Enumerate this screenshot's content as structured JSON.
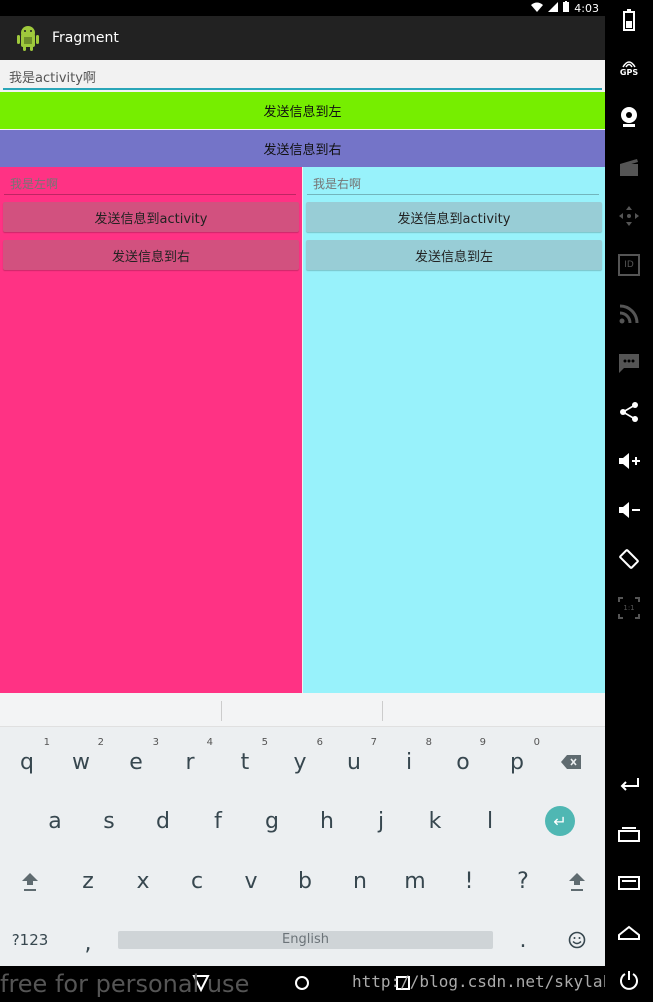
{
  "status_bar": {
    "time": "4:03"
  },
  "action_bar": {
    "title": "Fragment"
  },
  "activity": {
    "input_value": "我是activity啊",
    "send_left_label": "发送信息到左",
    "send_right_label": "发送信息到右",
    "send_left_color": "#76ee00",
    "send_right_color": "#7474c8"
  },
  "left_fragment": {
    "color": "#ff3284",
    "input_placeholder": "我是左啊",
    "button_activity": "发送信息到activity",
    "button_other": "发送信息到右"
  },
  "right_fragment": {
    "color": "#98f2fb",
    "input_placeholder": "我是右啊",
    "button_activity": "发送信息到activity",
    "button_other": "发送信息到左"
  },
  "keyboard": {
    "row1": [
      {
        "key": "q",
        "hint": "1"
      },
      {
        "key": "w",
        "hint": "2"
      },
      {
        "key": "e",
        "hint": "3"
      },
      {
        "key": "r",
        "hint": "4"
      },
      {
        "key": "t",
        "hint": "5"
      },
      {
        "key": "y",
        "hint": "6"
      },
      {
        "key": "u",
        "hint": "7"
      },
      {
        "key": "i",
        "hint": "8"
      },
      {
        "key": "o",
        "hint": "9"
      },
      {
        "key": "p",
        "hint": "0"
      }
    ],
    "row2": [
      "a",
      "s",
      "d",
      "f",
      "g",
      "h",
      "j",
      "k",
      "l"
    ],
    "row3": [
      "z",
      "x",
      "c",
      "v",
      "b",
      "n",
      "m",
      "!",
      "?"
    ],
    "symbols_label": "?123",
    "comma": ",",
    "space_label": "English",
    "period": ".",
    "icons": [
      "backspace-icon",
      "enter-icon",
      "shift-icon",
      "emoji-icon"
    ]
  },
  "nav_bar": {
    "icons": [
      "back-icon",
      "home-icon",
      "recents-icon"
    ]
  },
  "watermark": {
    "left_text": "free for personal use",
    "right_text": "http://blog.csdn.net/skylake"
  },
  "side_panel": {
    "gps_label": "GPS",
    "id_label": "ID",
    "scale_label": "1:1",
    "icons": [
      "battery-icon",
      "gps-icon",
      "camera-icon",
      "video-icon",
      "dpad-icon",
      "id-icon",
      "rss-icon",
      "sms-icon",
      "share-icon",
      "volume-up-icon",
      "volume-down-icon",
      "rotate-icon",
      "scale-icon",
      "back-icon",
      "recents-icon",
      "menu-icon",
      "home-icon",
      "power-icon"
    ]
  }
}
